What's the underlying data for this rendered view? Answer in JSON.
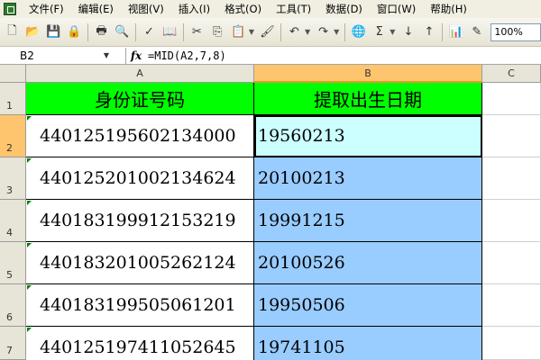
{
  "menu": {
    "items": [
      "文件(F)",
      "编辑(E)",
      "视图(V)",
      "插入(I)",
      "格式(O)",
      "工具(T)",
      "数据(D)",
      "窗口(W)",
      "帮助(H)"
    ]
  },
  "toolbar": {
    "zoom": "100%",
    "sum_symbol": "Σ"
  },
  "formula_bar": {
    "name_box": "B2",
    "fx_label": "fx",
    "formula": "=MID(A2,7,8)"
  },
  "columns": [
    "A",
    "B",
    "C"
  ],
  "rows": [
    {
      "num": "1",
      "a": "身份证号码",
      "b": "提取出生日期"
    },
    {
      "num": "2",
      "a": "440125195602134000",
      "b": "19560213"
    },
    {
      "num": "3",
      "a": "440125201002134624",
      "b": "20100213"
    },
    {
      "num": "4",
      "a": "440183199912153219",
      "b": "19991215"
    },
    {
      "num": "5",
      "a": "440183201005262124",
      "b": "20100526"
    },
    {
      "num": "6",
      "a": "440183199505061201",
      "b": "19950506"
    },
    {
      "num": "7",
      "a": "440125197411052645",
      "b": "19741105"
    }
  ]
}
